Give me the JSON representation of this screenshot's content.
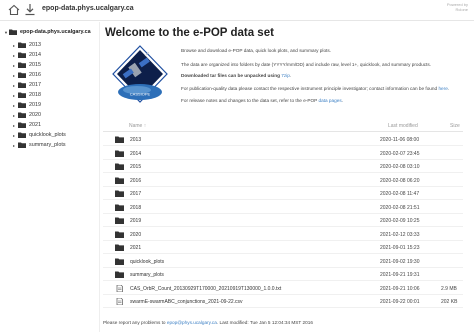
{
  "header": {
    "site_title": "epop-data.phys.ucalgary.ca",
    "top_right_line1": "Powered by",
    "top_right_line2": "Rclone"
  },
  "sidebar": {
    "root_label": "epop-data.phys.ucalgary.ca",
    "items": [
      {
        "label": "2013"
      },
      {
        "label": "2014"
      },
      {
        "label": "2015"
      },
      {
        "label": "2016"
      },
      {
        "label": "2017"
      },
      {
        "label": "2018"
      },
      {
        "label": "2019"
      },
      {
        "label": "2020"
      },
      {
        "label": "2021"
      },
      {
        "label": "quicklook_plots"
      },
      {
        "label": "summary_plots"
      }
    ]
  },
  "main": {
    "title": "Welcome to the e-POP data set",
    "logo_text": "CASSIOPE",
    "intro": {
      "line1": "Browse and download e-POP data, quick look plots, and summary plots.",
      "line2": "The data are organized into folders by date (YYYY/mm/DD) and include raw, level 1+, quicklook, and summary products.",
      "line3_prefix": "Downloaded tar files can be unpacked using ",
      "line3_link": "7zip",
      "line3_suffix": ".",
      "line4_prefix": "For publication-quality data please contact the respective instrument principle investigator; contact information can be found ",
      "line4_link": "here",
      "line4_suffix": ".",
      "line5_prefix": "For release notes and changes to the data set, refer to the e-POP ",
      "line5_link": "data pages",
      "line5_suffix": "."
    },
    "listing": {
      "header_name": "Name ↑",
      "header_modified": "Last modified",
      "header_size": "Size",
      "rows": [
        {
          "name": "2013",
          "type": "folder",
          "modified": "2020-11-06 08:00",
          "size": ""
        },
        {
          "name": "2014",
          "type": "folder",
          "modified": "2020-02-07 23:45",
          "size": ""
        },
        {
          "name": "2015",
          "type": "folder",
          "modified": "2020-02-08 03:10",
          "size": ""
        },
        {
          "name": "2016",
          "type": "folder",
          "modified": "2020-02-08 06:20",
          "size": ""
        },
        {
          "name": "2017",
          "type": "folder",
          "modified": "2020-02-08 11:47",
          "size": ""
        },
        {
          "name": "2018",
          "type": "folder",
          "modified": "2020-02-08 21:51",
          "size": ""
        },
        {
          "name": "2019",
          "type": "folder",
          "modified": "2020-02-09 10:25",
          "size": ""
        },
        {
          "name": "2020",
          "type": "folder",
          "modified": "2021-02-12 03:33",
          "size": ""
        },
        {
          "name": "2021",
          "type": "folder",
          "modified": "2021-09-01 15:23",
          "size": ""
        },
        {
          "name": "quicklook_plots",
          "type": "folder",
          "modified": "2021-09-02 19:30",
          "size": ""
        },
        {
          "name": "summary_plots",
          "type": "folder",
          "modified": "2021-09-21 19:31",
          "size": ""
        },
        {
          "name": "CAS_OrbR_Count_20130929T170000_20210919T130000_1.0.0.txt",
          "type": "file",
          "modified": "2021-09-21 10:06",
          "size": "2.9 MB"
        },
        {
          "name": "swarmE-swarmABC_conjunctions_2021-09-22.csv",
          "type": "file",
          "modified": "2021-09-22 00:01",
          "size": "202 KB"
        }
      ]
    },
    "footer": {
      "prefix": "Please report any problems to ",
      "email": "epop@phys.ucalgary.ca",
      "suffix": ". Last modified: Tue Jan 5 12:04:34 MST 2016"
    }
  },
  "colors": {
    "link": "#3b7fc4",
    "folder_icon": "#333333",
    "accent_blue": "#1f4fa0"
  },
  "icons": {
    "home": "home-icon",
    "download": "download-icon",
    "folder": "folder-icon",
    "file": "file-icon"
  }
}
